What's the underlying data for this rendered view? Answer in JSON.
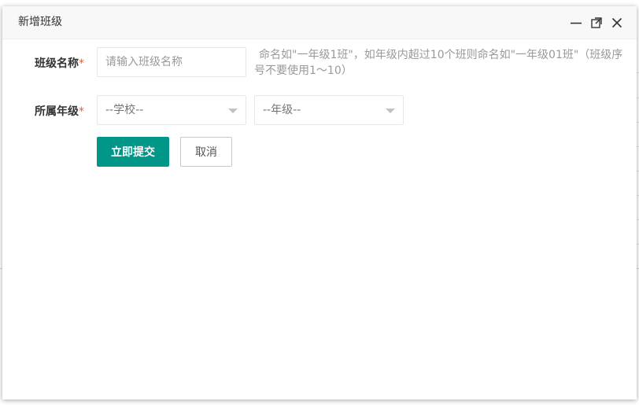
{
  "dialog": {
    "title": "新增班级"
  },
  "form": {
    "class_name": {
      "label": "班级名称",
      "required_mark": "*",
      "placeholder": "请输入班级名称",
      "value": "",
      "hint_line1": "命名如\"一年级1班\"，如年级内超过10个班则命名如\"一年级01班\"（班级序",
      "hint_line2": "号不要使用1～10）"
    },
    "grade": {
      "label": "所属年级",
      "required_mark": "*",
      "school_select": "--学校--",
      "grade_select": "--年级--"
    }
  },
  "buttons": {
    "submit": "立即提交",
    "cancel": "取消"
  },
  "colors": {
    "primary": "#009688",
    "required": "#ff5722",
    "header_bg": "#f8f8f8"
  },
  "icons": [
    "minimize-icon",
    "maximize-icon",
    "close-icon"
  ]
}
